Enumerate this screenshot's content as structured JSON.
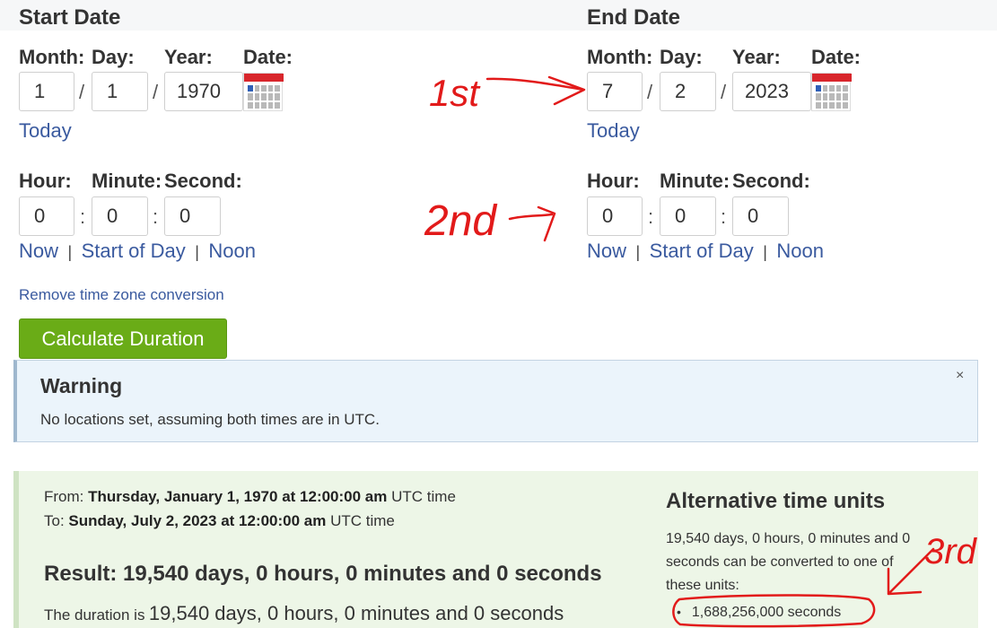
{
  "start": {
    "heading": "Start Date",
    "labels": {
      "month": "Month:",
      "day": "Day:",
      "year": "Year:",
      "date": "Date:",
      "hour": "Hour:",
      "minute": "Minute:",
      "second": "Second:"
    },
    "month": "1",
    "day": "1",
    "year": "1970",
    "hour": "0",
    "minute": "0",
    "second": "0",
    "today_link": "Today",
    "time_links": [
      "Now",
      "Start of Day",
      "Noon"
    ]
  },
  "end": {
    "heading": "End Date",
    "labels": {
      "month": "Month:",
      "day": "Day:",
      "year": "Year:",
      "date": "Date:",
      "hour": "Hour:",
      "minute": "Minute:",
      "second": "Second:"
    },
    "month": "7",
    "day": "2",
    "year": "2023",
    "hour": "0",
    "minute": "0",
    "second": "0",
    "today_link": "Today",
    "time_links": [
      "Now",
      "Start of Day",
      "Noon"
    ]
  },
  "separators": {
    "date": "/",
    "time": ":",
    "pipe": "|"
  },
  "remove_tz_link": "Remove time zone conversion",
  "calculate_button": "Calculate Duration",
  "warning": {
    "title": "Warning",
    "message": "No locations set, assuming both times are in UTC.",
    "close_symbol": "×"
  },
  "result": {
    "from_label": "From:",
    "from_value": "Thursday, January 1, 1970 at 12:00:00 am",
    "from_suffix": "UTC time",
    "to_label": "To:",
    "to_value": "Sunday, July 2, 2023 at 12:00:00 am",
    "to_suffix": "UTC time",
    "result_line": "Result: 19,540 days, 0 hours, 0 minutes and 0 seconds",
    "duration_prefix": "The duration is",
    "duration_value": "19,540 days, 0 hours, 0 minutes and 0 seconds"
  },
  "alternative": {
    "heading": "Alternative time units",
    "text_line1": "19,540 days, 0 hours, 0 minutes and 0",
    "text_line2": "seconds can be converted to one of",
    "text_line3": "these units:",
    "items": [
      "1,688,256,000 seconds"
    ]
  },
  "annotations": {
    "first": "1st",
    "second": "2nd",
    "third": "3rd",
    "ink_color": "#e21a1a"
  },
  "colors": {
    "button": "#6aac17",
    "link": "#3a5a9f",
    "warning_bg": "#ebf4fb",
    "result_bg": "#edf6e7"
  }
}
